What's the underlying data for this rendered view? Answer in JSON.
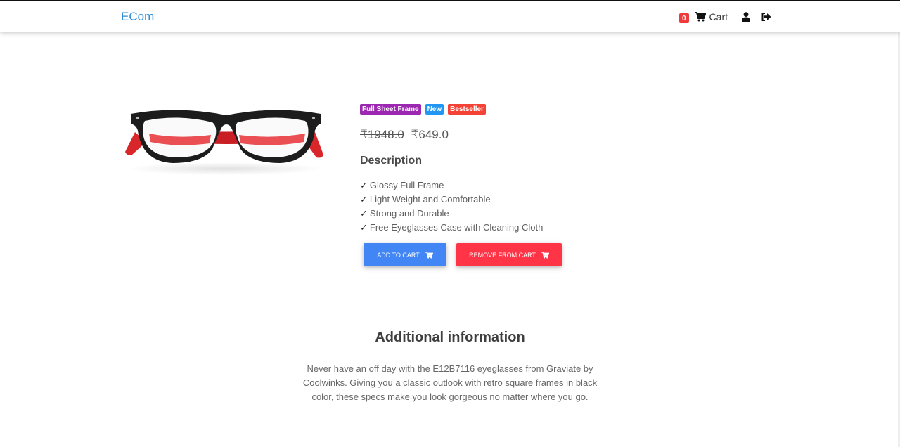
{
  "nav": {
    "brand": "ECom",
    "cart_count": "0",
    "cart_label": "Cart"
  },
  "product": {
    "badges": [
      {
        "label": "Full Sheet Frame",
        "color": "#9c27b0"
      },
      {
        "label": "New",
        "color": "#2196f3"
      },
      {
        "label": "Bestseller",
        "color": "#f44336"
      }
    ],
    "old_price": "₹1948.0",
    "price": "₹649.0",
    "description_title": "Description",
    "features": [
      "Glossy Full Frame",
      "Light Weight and Comfortable",
      "Strong and Durable",
      "Free Eyeglasses Case with Cleaning Cloth"
    ],
    "check_mark": "✓",
    "add_to_cart": "ADD TO CART",
    "remove_from_cart": "REMOVE FROM CART"
  },
  "additional": {
    "title": "Additional information",
    "text": "Never have an off day with the E12B7116 eyeglasses from Graviate by Coolwinks. Giving you a classic outlook with retro square frames in black color, these specs make you look gorgeous no matter where you go."
  },
  "colors": {
    "brand": "#2b8cd6",
    "primary": "#4285f4",
    "danger": "#ff3547"
  },
  "icons": [
    "cart-icon",
    "user-icon",
    "sign-out-icon"
  ]
}
